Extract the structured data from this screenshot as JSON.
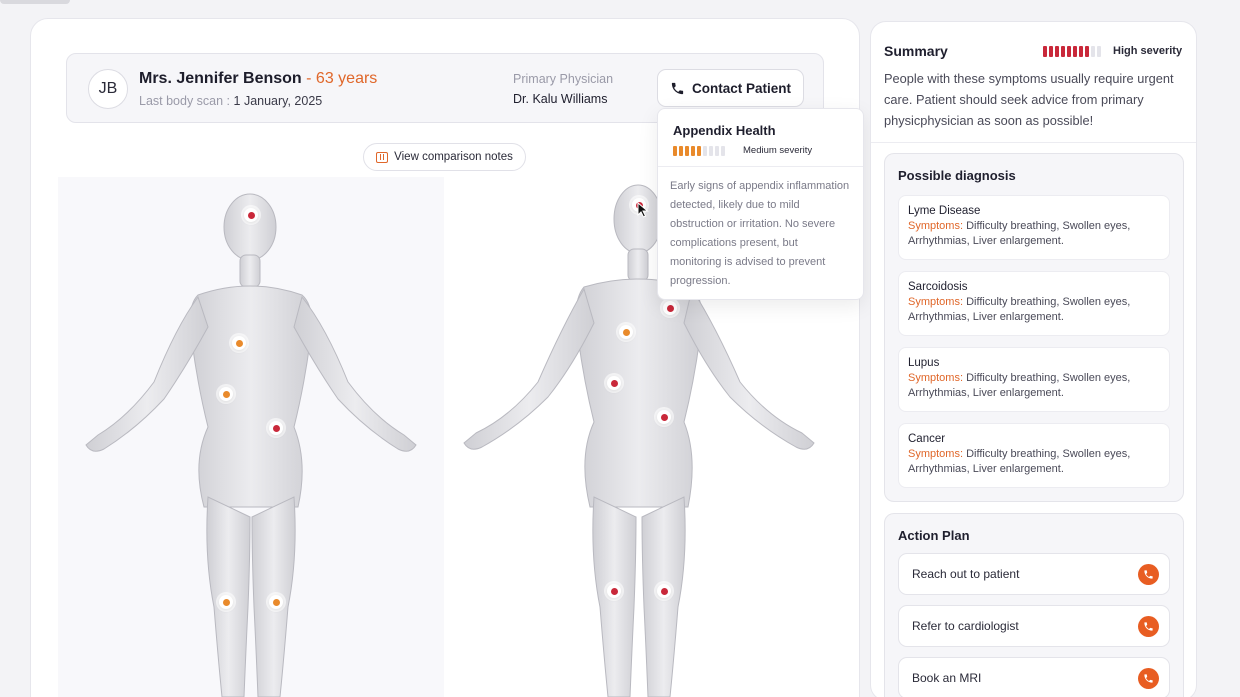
{
  "patient": {
    "initials": "JB",
    "name": "Mrs. Jennifer Benson",
    "age": " - 63 years",
    "last_scan_label": "Last body scan : ",
    "last_scan_date": "1 January, 2025",
    "physician_label": "Primary Physician",
    "physician_name": "Dr. Kalu Williams",
    "contact_label": "Contact Patient"
  },
  "comparison": {
    "label": "View comparison notes"
  },
  "tooltip": {
    "title": "Appendix Health",
    "severity_label": "Medium severity",
    "severity_filled": 5,
    "severity_total": 9,
    "body": "Early signs of appendix inflammation detected, likely due to mild obstruction or irritation. No severe complications present, but monitoring is advised to prevent progression."
  },
  "summary": {
    "title": "Summary",
    "severity_label": "High severity",
    "severity_filled": 8,
    "severity_total": 10,
    "text": "People with these symptoms usually require urgent care. Patient should seek advice from primary physicphysician as soon as possible!"
  },
  "diagnosis": {
    "title": "Possible diagnosis",
    "symptoms_label": "Symptoms: ",
    "items": [
      {
        "name": "Lyme Disease",
        "symptoms": "Difficulty breathing, Swollen eyes, Arrhythmias, Liver enlargement."
      },
      {
        "name": "Sarcoidosis",
        "symptoms": "Difficulty breathing, Swollen eyes, Arrhythmias, Liver enlargement."
      },
      {
        "name": "Lupus",
        "symptoms": "Difficulty breathing, Swollen eyes, Arrhythmias, Liver enlargement."
      },
      {
        "name": "Cancer",
        "symptoms": "Difficulty breathing, Swollen eyes, Arrhythmias, Liver enlargement."
      }
    ]
  },
  "action_plan": {
    "title": "Action Plan",
    "items": [
      {
        "label": "Reach out to patient"
      },
      {
        "label": "Refer to cardiologist"
      },
      {
        "label": "Book an MRI"
      }
    ]
  },
  "colors": {
    "accent": "#e0672a",
    "high": "#c9283a",
    "medium": "#e98a2b",
    "empty": "#e4e4ea"
  }
}
